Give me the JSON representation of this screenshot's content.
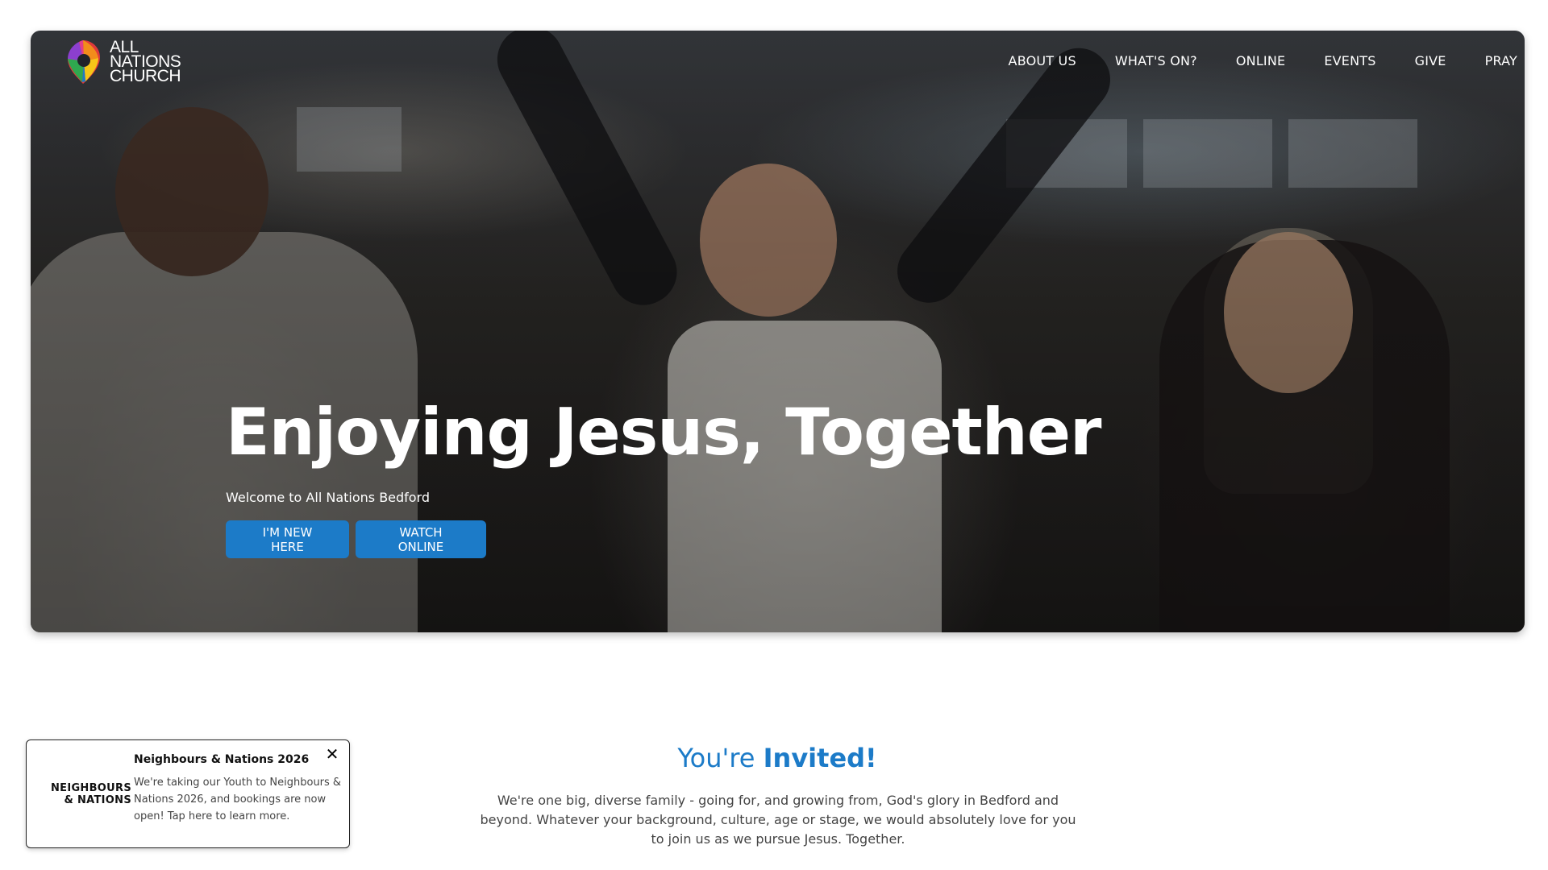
{
  "header": {
    "logo_lines": [
      "ALL",
      "NATIONS",
      "CHURCH"
    ],
    "nav": [
      {
        "label": "ABOUT US"
      },
      {
        "label": "WHAT'S ON?"
      },
      {
        "label": "ONLINE"
      },
      {
        "label": "EVENTS"
      },
      {
        "label": "GIVE"
      },
      {
        "label": "PRAY"
      }
    ]
  },
  "hero": {
    "title": "Enjoying Jesus, Together",
    "subtitle": "Welcome to All Nations Bedford",
    "buttons": {
      "new_here": "I'M NEW HERE",
      "watch_online": "WATCH ONLINE"
    }
  },
  "invited": {
    "heading_prefix": "You're ",
    "heading_accent": "Invited!",
    "body": "We're one big, diverse family - going for, and growing from, God's glory in Bedford and beyond. Whatever your background, culture, age or stage, we would absolutely love for you to join us as we pursue Jesus. Together."
  },
  "popup": {
    "logo_line1": "NEIGHBOURS",
    "logo_line2": "& NATIONS",
    "title": "Neighbours & Nations 2026",
    "text": "We're taking our Youth to Neighbours & Nations 2026, and bookings are now open! Tap here to learn more.",
    "close_symbol": "✕"
  },
  "colors": {
    "accent": "#1c7bc8",
    "text_gray": "#444444"
  }
}
